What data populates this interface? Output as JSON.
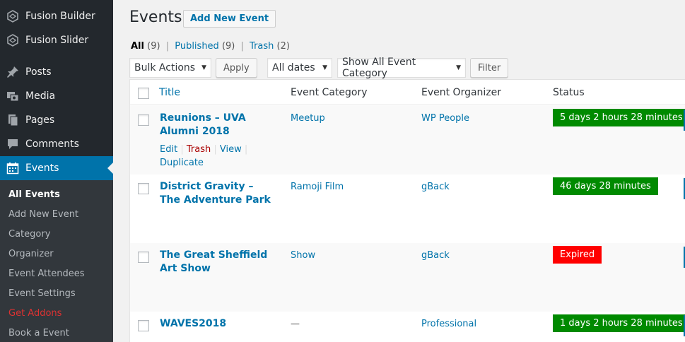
{
  "sidebar": {
    "top_items": [
      {
        "label": "Fusion Builder",
        "icon": "fusion-builder-icon"
      },
      {
        "label": "Fusion Slider",
        "icon": "fusion-slider-icon"
      },
      {
        "label": "Posts",
        "icon": "pin-icon"
      },
      {
        "label": "Media",
        "icon": "media-icon"
      },
      {
        "label": "Pages",
        "icon": "pages-icon"
      },
      {
        "label": "Comments",
        "icon": "comment-icon"
      },
      {
        "label": "Events",
        "icon": "calendar-icon"
      }
    ],
    "submenu": [
      {
        "label": "All Events"
      },
      {
        "label": "Add New Event"
      },
      {
        "label": "Category"
      },
      {
        "label": "Organizer"
      },
      {
        "label": "Event Attendees"
      },
      {
        "label": "Event Settings"
      },
      {
        "label": "Get Addons"
      },
      {
        "label": "Book a Event"
      }
    ]
  },
  "header": {
    "title": "Events",
    "add_new": "Add New Event"
  },
  "filters_links": {
    "all": "All",
    "all_count": "(9)",
    "published": "Published",
    "published_count": "(9)",
    "trash": "Trash",
    "trash_count": "(2)",
    "sep": "|"
  },
  "toolbar": {
    "bulk_actions": "Bulk Actions",
    "apply": "Apply",
    "dates": "All dates",
    "category": "Show All Event Category",
    "filter": "Filter"
  },
  "table": {
    "columns": {
      "title": "Title",
      "category": "Event Category",
      "organizer": "Event Organizer",
      "status": "Status"
    },
    "rows": [
      {
        "title": "Reunions – UVA Alumni 2018",
        "category": "Meetup",
        "organizer": "WP People",
        "status": "5 days 2 hours 28 minutes",
        "status_color": "#008a00"
      },
      {
        "title": "District Gravity – The Adventure Park",
        "category": "Ramoji Film",
        "organizer": "gBack",
        "status": "46 days 28 minutes",
        "status_color": "#008a00"
      },
      {
        "title": "The Great Sheffield Art Show",
        "category": "Show",
        "organizer": "gBack",
        "status": "Expired",
        "status_color": "#ff0000"
      },
      {
        "title": "WAVES2018",
        "category": "—",
        "organizer": "Professional",
        "status": "1 days 2 hours 28 minutes",
        "status_color": "#008a00"
      }
    ],
    "row_actions": {
      "edit": "Edit",
      "trash": "Trash",
      "view": "View",
      "duplicate": "Duplicate",
      "sep": "|"
    }
  },
  "colors": {
    "sidebar_bg": "#23282d",
    "submenu_bg": "#32373c",
    "accent": "#0073aa",
    "status_active": "#008a00",
    "status_expired": "#ff0000"
  }
}
